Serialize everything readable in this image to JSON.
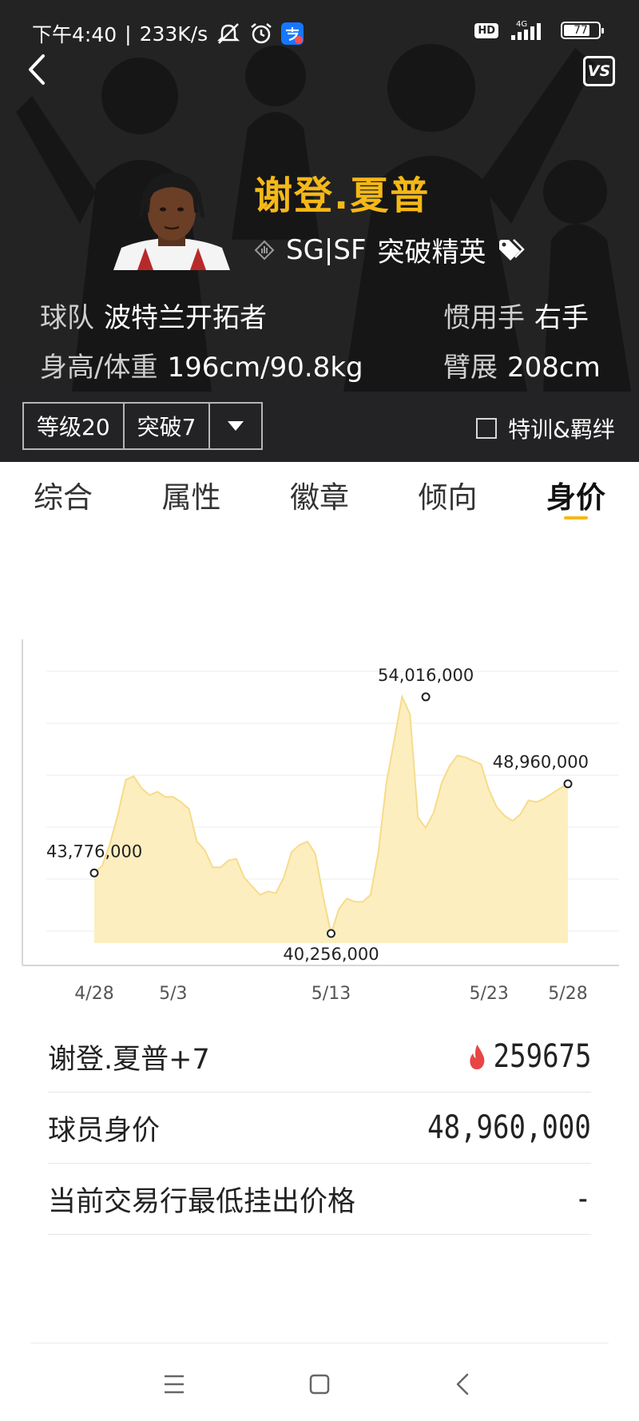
{
  "status_bar": {
    "time": "下午4:40",
    "speed": "233K/s",
    "hd": "HD",
    "network": "4G",
    "battery": "77",
    "battery_level": 0.77
  },
  "player": {
    "name": "谢登.夏普",
    "positions": "SG|SF",
    "archetype": "突破精英",
    "team_label": "球队",
    "team": "波特兰开拓者",
    "hand_label": "惯用手",
    "hand": "右手",
    "height_weight_label": "身高/体重",
    "height_weight": "196cm/90.8kg",
    "wingspan_label": "臂展",
    "wingspan": "208cm"
  },
  "header": {
    "vs_label": "VS"
  },
  "controls": {
    "level": "等级20",
    "breakthrough": "突破7",
    "training_label": "特训&羁绊"
  },
  "tabs": [
    {
      "label": "综合",
      "active": false
    },
    {
      "label": "属性",
      "active": false
    },
    {
      "label": "徽章",
      "active": false
    },
    {
      "label": "倾向",
      "active": false
    },
    {
      "label": "身价",
      "active": true
    }
  ],
  "chart_data": {
    "type": "area",
    "x_ticks": [
      "4/28",
      "5/3",
      "5/13",
      "5/23",
      "5/28"
    ],
    "x_tick_days": [
      0,
      5,
      15,
      25,
      30
    ],
    "y_gridlines": 6,
    "ylim": [
      39700000,
      55500000
    ],
    "color": "#fdeec0",
    "stroke": "#f6dc8a",
    "x": [
      0,
      0.5,
      1,
      1.5,
      2,
      2.5,
      3,
      3.5,
      4,
      4.5,
      5,
      5.5,
      6,
      6.5,
      7,
      7.5,
      8,
      8.5,
      9,
      9.5,
      10,
      10.5,
      11,
      11.5,
      12,
      12.5,
      13,
      13.5,
      14,
      14.5,
      15,
      15.5,
      16,
      16.5,
      17,
      17.5,
      18,
      18.5,
      19,
      19.5,
      20,
      20.5,
      21,
      21.5,
      22,
      22.5,
      23,
      23.5,
      24,
      24.5,
      25,
      25.5,
      26,
      26.5,
      27,
      27.5,
      28,
      28.5,
      29,
      29.5,
      30
    ],
    "y": [
      43776000,
      44200000,
      45500000,
      47200000,
      49200000,
      49400000,
      48700000,
      48300000,
      48500000,
      48200000,
      48200000,
      47900000,
      47500000,
      45600000,
      45100000,
      44100000,
      44100000,
      44500000,
      44600000,
      43500000,
      43000000,
      42500000,
      42700000,
      42600000,
      43500000,
      45000000,
      45400000,
      45600000,
      44900000,
      42400000,
      40256000,
      41700000,
      42300000,
      42100000,
      42100000,
      42500000,
      45000000,
      49000000,
      51500000,
      54016000,
      53000000,
      47000000,
      46400000,
      47300000,
      49000000,
      50000000,
      50600000,
      50500000,
      50300000,
      50100000,
      48600000,
      47600000,
      47100000,
      46800000,
      47200000,
      48000000,
      47900000,
      48100000,
      48400000,
      48700000,
      48960000
    ],
    "annotations": [
      {
        "x": 0,
        "y": 43776000,
        "label": "43,776,000",
        "pos": "above-right"
      },
      {
        "x": 15,
        "y": 40256000,
        "label": "40,256,000",
        "pos": "below"
      },
      {
        "x": 21,
        "y": 54016000,
        "label": "54,016,000",
        "pos": "above"
      },
      {
        "x": 30,
        "y": 48960000,
        "label": "48,960,000",
        "pos": "above-left"
      }
    ]
  },
  "stats": {
    "plus_label": "谢登.夏普+7",
    "plus_value": "259675",
    "price_label": "球员身价",
    "price_value": "48,960,000",
    "lowest_label": "当前交易行最低挂出价格",
    "lowest_value": "-"
  }
}
